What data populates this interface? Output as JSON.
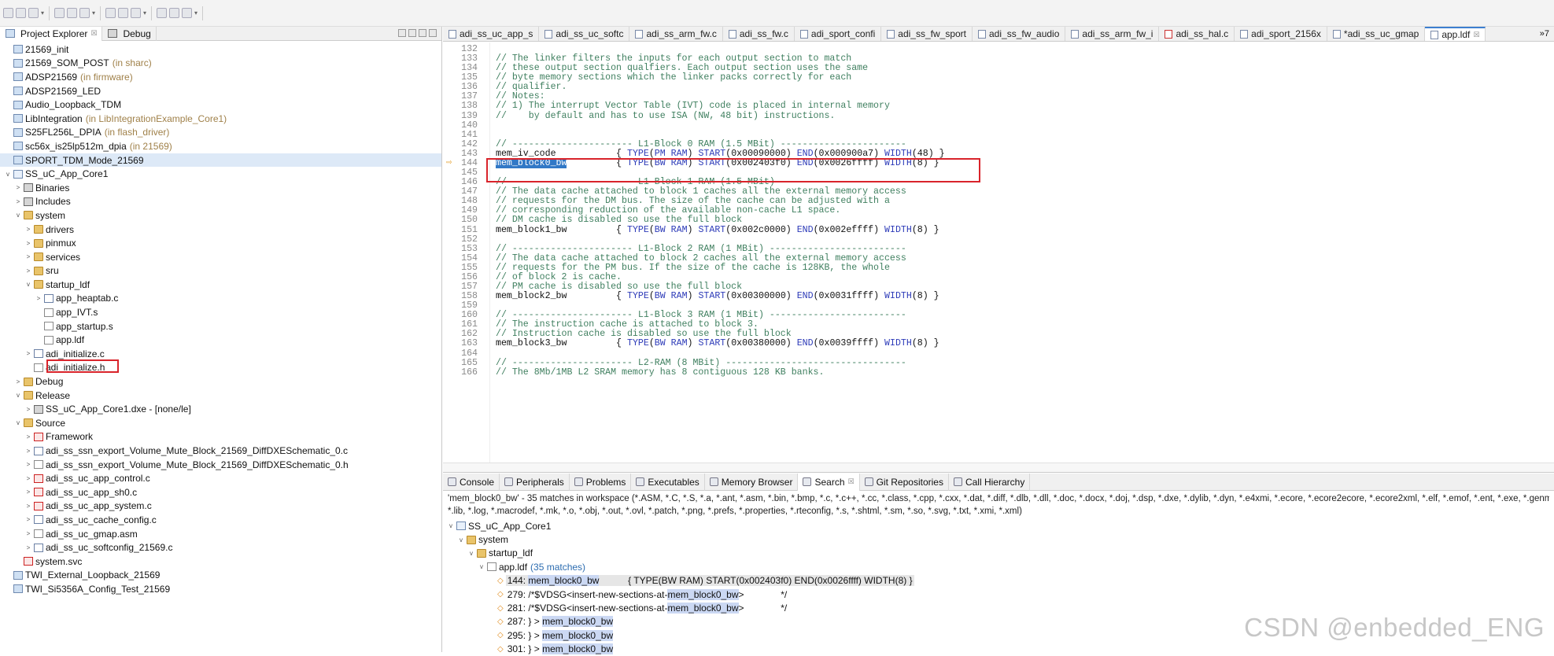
{
  "toolbar": {
    "buttons": [
      "new",
      "save",
      "save-all",
      "print",
      "debug",
      "run",
      "stop",
      "step",
      "build",
      "search",
      "back",
      "forward"
    ]
  },
  "explorer": {
    "tabs": [
      {
        "label": "Project Explorer",
        "closable": "☒"
      },
      {
        "label": "Debug"
      }
    ],
    "rows": [
      {
        "indent": 0,
        "tw": "",
        "icon": "proj",
        "label": "21569_init",
        "extra": ""
      },
      {
        "indent": 0,
        "tw": "",
        "icon": "proj",
        "label": "21569_SOM_POST",
        "extra": "(in sharc)"
      },
      {
        "indent": 0,
        "tw": "",
        "icon": "proj",
        "label": "ADSP21569",
        "extra": "(in firmware)"
      },
      {
        "indent": 0,
        "tw": "",
        "icon": "proj",
        "label": "ADSP21569_LED",
        "extra": ""
      },
      {
        "indent": 0,
        "tw": "",
        "icon": "proj",
        "label": "Audio_Loopback_TDM",
        "extra": ""
      },
      {
        "indent": 0,
        "tw": "",
        "icon": "proj",
        "label": "LibIntegration",
        "extra": "(in LibIntegrationExample_Core1)"
      },
      {
        "indent": 0,
        "tw": "",
        "icon": "proj",
        "label": "S25FL256L_DPIA",
        "extra": "(in flash_driver)"
      },
      {
        "indent": 0,
        "tw": "",
        "icon": "proj",
        "label": "sc56x_is25lp512m_dpia",
        "extra": "(in 21569)"
      },
      {
        "indent": 0,
        "tw": "",
        "icon": "proj",
        "label": "SPORT_TDM_Mode_21569",
        "extra": "",
        "sel": true
      },
      {
        "indent": 0,
        "tw": "v",
        "icon": "proj open",
        "label": "SS_uC_App_Core1",
        "extra": ""
      },
      {
        "indent": 1,
        "tw": ">",
        "icon": "binr",
        "label": "Binaries",
        "extra": ""
      },
      {
        "indent": 1,
        "tw": ">",
        "icon": "binr",
        "label": "Includes",
        "extra": ""
      },
      {
        "indent": 1,
        "tw": "v",
        "icon": "fold",
        "label": "system",
        "extra": ""
      },
      {
        "indent": 2,
        "tw": ">",
        "icon": "fold",
        "label": "drivers",
        "extra": ""
      },
      {
        "indent": 2,
        "tw": ">",
        "icon": "fold",
        "label": "pinmux",
        "extra": ""
      },
      {
        "indent": 2,
        "tw": ">",
        "icon": "fold",
        "label": "services",
        "extra": ""
      },
      {
        "indent": 2,
        "tw": ">",
        "icon": "fold",
        "label": "sru",
        "extra": ""
      },
      {
        "indent": 2,
        "tw": "v",
        "icon": "fold",
        "label": "startup_ldf",
        "extra": ""
      },
      {
        "indent": 3,
        "tw": ">",
        "icon": "file c",
        "label": "app_heaptab.c",
        "extra": ""
      },
      {
        "indent": 3,
        "tw": "",
        "icon": "file",
        "label": "app_IVT.s",
        "extra": ""
      },
      {
        "indent": 3,
        "tw": "",
        "icon": "file",
        "label": "app_startup.s",
        "extra": ""
      },
      {
        "indent": 3,
        "tw": "",
        "icon": "file",
        "label": "app.ldf",
        "extra": "",
        "boxed": true
      },
      {
        "indent": 2,
        "tw": ">",
        "icon": "file c",
        "label": "adi_initialize.c",
        "extra": ""
      },
      {
        "indent": 2,
        "tw": "",
        "icon": "file",
        "label": "adi_initialize.h",
        "extra": ""
      },
      {
        "indent": 1,
        "tw": ">",
        "icon": "fold",
        "label": "Debug",
        "extra": ""
      },
      {
        "indent": 1,
        "tw": "v",
        "icon": "fold",
        "label": "Release",
        "extra": ""
      },
      {
        "indent": 2,
        "tw": ">",
        "icon": "binr",
        "label": "SS_uC_App_Core1.dxe - [none/le]",
        "extra": ""
      },
      {
        "indent": 1,
        "tw": "v",
        "icon": "fold",
        "label": "Source",
        "extra": ""
      },
      {
        "indent": 2,
        "tw": ">",
        "icon": "file red",
        "label": "Framework",
        "extra": ""
      },
      {
        "indent": 2,
        "tw": ">",
        "icon": "file c",
        "label": "adi_ss_ssn_export_Volume_Mute_Block_21569_DiffDXESchematic_0.c",
        "extra": ""
      },
      {
        "indent": 2,
        "tw": ">",
        "icon": "file",
        "label": "adi_ss_ssn_export_Volume_Mute_Block_21569_DiffDXESchematic_0.h",
        "extra": ""
      },
      {
        "indent": 2,
        "tw": ">",
        "icon": "file red",
        "label": "adi_ss_uc_app_control.c",
        "extra": ""
      },
      {
        "indent": 2,
        "tw": ">",
        "icon": "file red",
        "label": "adi_ss_uc_app_sh0.c",
        "extra": ""
      },
      {
        "indent": 2,
        "tw": ">",
        "icon": "file red",
        "label": "adi_ss_uc_app_system.c",
        "extra": ""
      },
      {
        "indent": 2,
        "tw": ">",
        "icon": "file c",
        "label": "adi_ss_uc_cache_config.c",
        "extra": ""
      },
      {
        "indent": 2,
        "tw": ">",
        "icon": "file",
        "label": "adi_ss_uc_gmap.asm",
        "extra": ""
      },
      {
        "indent": 2,
        "tw": ">",
        "icon": "file c",
        "label": "adi_ss_uc_softconfig_21569.c",
        "extra": ""
      },
      {
        "indent": 1,
        "tw": "",
        "icon": "file red",
        "label": "system.svc",
        "extra": ""
      },
      {
        "indent": 0,
        "tw": "",
        "icon": "proj",
        "label": "TWI_External_Loopback_21569",
        "extra": ""
      },
      {
        "indent": 0,
        "tw": "",
        "icon": "proj",
        "label": "TWI_Si5356A_Config_Test_21569",
        "extra": ""
      }
    ]
  },
  "editor": {
    "tabs": [
      {
        "label": "adi_ss_uc_app_s",
        "red": false
      },
      {
        "label": "adi_ss_uc_softc",
        "red": false
      },
      {
        "label": "adi_ss_arm_fw.c",
        "red": false
      },
      {
        "label": "adi_ss_fw.c",
        "red": false
      },
      {
        "label": "adi_sport_confi",
        "red": false
      },
      {
        "label": "adi_ss_fw_sport",
        "red": false
      },
      {
        "label": "adi_ss_fw_audio",
        "red": false
      },
      {
        "label": "adi_ss_arm_fw_i",
        "red": false
      },
      {
        "label": "adi_ss_hal.c",
        "red": true
      },
      {
        "label": "adi_sport_2156x",
        "red": false
      },
      {
        "label": "*adi_ss_uc_gmap",
        "red": false
      },
      {
        "label": "app.ldf",
        "red": false,
        "active": true,
        "closable": "☒"
      }
    ],
    "overflow": "»7",
    "lines": [
      {
        "n": "132",
        "segs": []
      },
      {
        "n": "133",
        "segs": [
          [
            "cm",
            "// The linker filters the inputs for each output section to match"
          ]
        ]
      },
      {
        "n": "134",
        "segs": [
          [
            "cm",
            "// these output section qualfiers. Each output section uses the same"
          ]
        ]
      },
      {
        "n": "135",
        "segs": [
          [
            "cm",
            "// byte memory sections which the linker packs correctly for each"
          ]
        ]
      },
      {
        "n": "136",
        "segs": [
          [
            "cm",
            "// qualifier."
          ]
        ]
      },
      {
        "n": "137",
        "segs": [
          [
            "cm",
            "// Notes:"
          ]
        ]
      },
      {
        "n": "138",
        "segs": [
          [
            "cm",
            "// 1) The interrupt Vector Table (IVT) code is placed in internal memory"
          ]
        ]
      },
      {
        "n": "139",
        "segs": [
          [
            "cm",
            "//    by default and has to use ISA (NW, 48 bit) instructions."
          ]
        ]
      },
      {
        "n": "140",
        "segs": []
      },
      {
        "n": "141",
        "segs": []
      },
      {
        "n": "142",
        "segs": [
          [
            "cm",
            "// ---------------------- L1-Block 0 RAM (1.5 MBit) -----------------------"
          ]
        ]
      },
      {
        "n": "143",
        "segs": [
          [
            "",
            "mem_iv_code           { "
          ],
          [
            "kw",
            "TYPE"
          ],
          [
            "",
            "("
          ],
          [
            "kw",
            "PM RAM"
          ],
          [
            "",
            ") "
          ],
          [
            "kw",
            "START"
          ],
          [
            "",
            "(0x00090000) "
          ],
          [
            "kw",
            "END"
          ],
          [
            "",
            "(0x000900a7) "
          ],
          [
            "kw",
            "WIDTH"
          ],
          [
            "",
            "(48) }"
          ]
        ]
      },
      {
        "n": "144",
        "mark": "⇨",
        "segs": [
          [
            "hl",
            "mem_block0_bw"
          ],
          [
            "",
            "         { "
          ],
          [
            "kw",
            "TYPE"
          ],
          [
            "",
            "("
          ],
          [
            "kw",
            "BW RAM"
          ],
          [
            "",
            ") "
          ],
          [
            "kw",
            "START"
          ],
          [
            "",
            "(0x002403f0) "
          ],
          [
            "kw",
            "END"
          ],
          [
            "",
            "(0x0026ffff) "
          ],
          [
            "kw",
            "WIDTH"
          ],
          [
            "",
            "(8) }"
          ]
        ]
      },
      {
        "n": "145",
        "segs": []
      },
      {
        "n": "146",
        "segs": [
          [
            "cm",
            "// ---------------------- L1-Block 1 RAM (1.5 MBit) -----------------------"
          ]
        ]
      },
      {
        "n": "147",
        "segs": [
          [
            "cm",
            "// The data cache attached to block 1 caches all the external memory access"
          ]
        ]
      },
      {
        "n": "148",
        "segs": [
          [
            "cm",
            "// requests for the DM bus. The size of the cache can be adjusted with a"
          ]
        ]
      },
      {
        "n": "149",
        "segs": [
          [
            "cm",
            "// corresponding reduction of the available non-cache L1 space."
          ]
        ]
      },
      {
        "n": "150",
        "segs": [
          [
            "cm",
            "// DM cache is disabled so use the full block"
          ]
        ]
      },
      {
        "n": "151",
        "segs": [
          [
            "",
            "mem_block1_bw         { "
          ],
          [
            "kw",
            "TYPE"
          ],
          [
            "",
            "("
          ],
          [
            "kw",
            "BW RAM"
          ],
          [
            "",
            ") "
          ],
          [
            "kw",
            "START"
          ],
          [
            "",
            "(0x002c0000) "
          ],
          [
            "kw",
            "END"
          ],
          [
            "",
            "(0x002effff) "
          ],
          [
            "kw",
            "WIDTH"
          ],
          [
            "",
            "(8) }"
          ]
        ]
      },
      {
        "n": "152",
        "segs": []
      },
      {
        "n": "153",
        "segs": [
          [
            "cm",
            "// ---------------------- L1-Block 2 RAM (1 MBit) -------------------------"
          ]
        ]
      },
      {
        "n": "154",
        "segs": [
          [
            "cm",
            "// The data cache attached to block 2 caches all the external memory access"
          ]
        ]
      },
      {
        "n": "155",
        "segs": [
          [
            "cm",
            "// requests for the PM bus. If the size of the cache is 128KB, the whole"
          ]
        ]
      },
      {
        "n": "156",
        "segs": [
          [
            "cm",
            "// of block 2 is cache."
          ]
        ]
      },
      {
        "n": "157",
        "segs": [
          [
            "cm",
            "// PM cache is disabled so use the full block"
          ]
        ]
      },
      {
        "n": "158",
        "segs": [
          [
            "",
            "mem_block2_bw         { "
          ],
          [
            "kw",
            "TYPE"
          ],
          [
            "",
            "("
          ],
          [
            "kw",
            "BW RAM"
          ],
          [
            "",
            ") "
          ],
          [
            "kw",
            "START"
          ],
          [
            "",
            "(0x00300000) "
          ],
          [
            "kw",
            "END"
          ],
          [
            "",
            "(0x0031ffff) "
          ],
          [
            "kw",
            "WIDTH"
          ],
          [
            "",
            "(8) }"
          ]
        ]
      },
      {
        "n": "159",
        "segs": []
      },
      {
        "n": "160",
        "segs": [
          [
            "cm",
            "// ---------------------- L1-Block 3 RAM (1 MBit) -------------------------"
          ]
        ]
      },
      {
        "n": "161",
        "segs": [
          [
            "cm",
            "// The instruction cache is attached to block 3."
          ]
        ]
      },
      {
        "n": "162",
        "segs": [
          [
            "cm",
            "// Instruction cache is disabled so use the full block"
          ]
        ]
      },
      {
        "n": "163",
        "segs": [
          [
            "",
            "mem_block3_bw         { "
          ],
          [
            "kw",
            "TYPE"
          ],
          [
            "",
            "("
          ],
          [
            "kw",
            "BW RAM"
          ],
          [
            "",
            ") "
          ],
          [
            "kw",
            "START"
          ],
          [
            "",
            "(0x00380000) "
          ],
          [
            "kw",
            "END"
          ],
          [
            "",
            "(0x0039ffff) "
          ],
          [
            "kw",
            "WIDTH"
          ],
          [
            "",
            "(8) }"
          ]
        ]
      },
      {
        "n": "164",
        "segs": []
      },
      {
        "n": "165",
        "segs": [
          [
            "cm",
            "// ---------------------- L2-RAM (8 MBit) ---------------------------------"
          ]
        ]
      },
      {
        "n": "166",
        "segs": [
          [
            "cm",
            "// The 8Mb/1MB L2 SRAM memory has 8 contiguous 128 KB banks."
          ]
        ]
      }
    ]
  },
  "bottom": {
    "tabs": [
      {
        "label": "Console"
      },
      {
        "label": "Peripherals"
      },
      {
        "label": "Problems"
      },
      {
        "label": "Executables"
      },
      {
        "label": "Memory Browser"
      },
      {
        "label": "Search",
        "active": true,
        "closable": "☒"
      },
      {
        "label": "Git Repositories"
      },
      {
        "label": "Call Hierarchy"
      }
    ],
    "summary1": "'mem_block0_bw' - 35 matches in workspace (*.ASM, *.C, *.S, *.a, *.ant, *.asm, *.bin, *.bmp, *.c, *.c++, *.cc, *.class, *.cpp, *.cxx, *.dat, *.diff, *.dlb, *.dll, *.doc, *.docx, *.doj, *.dsp, *.dxe, *.dylib, *.dyn, *.e4xmi, *.ecore, *.ecore2ecore, *.ecore2xml, *.elf, *.emof, *.ent, *.exe, *.genmodel, *.gif, *.gitignore, *.h",
    "summary2": "*.lib, *.log, *.macrodef, *.mk, *.o, *.obj, *.out, *.ovl, *.patch, *.png, *.prefs, *.properties, *.rteconfig, *.s, *.shtml, *.sm, *.so, *.svg, *.txt, *.xmi, *.xml)",
    "tree": [
      {
        "indent": 0,
        "tw": "v",
        "icon": "proj open",
        "label": "SS_uC_App_Core1"
      },
      {
        "indent": 1,
        "tw": "v",
        "icon": "fold",
        "label": "system"
      },
      {
        "indent": 2,
        "tw": "v",
        "icon": "fold",
        "label": "startup_ldf"
      },
      {
        "indent": 3,
        "tw": "v",
        "icon": "file",
        "label": "app.ldf",
        "count": "(35 matches)"
      }
    ],
    "results": [
      {
        "prefix": "144: ",
        "match": "mem_block0_bw",
        "suffix": "           { TYPE(BW RAM) START(0x002403f0) END(0x0026ffff) WIDTH(8) }",
        "row": true
      },
      {
        "prefix": "279: /*$VDSG<insert-new-sections-at-",
        "match": "mem_block0_bw",
        "suffix": ">              */"
      },
      {
        "prefix": "281: /*$VDSG<insert-new-sections-at-",
        "match": "mem_block0_bw",
        "suffix": ">              */"
      },
      {
        "prefix": "287: } > ",
        "match": "mem_block0_bw",
        "suffix": ""
      },
      {
        "prefix": "295: } > ",
        "match": "mem_block0_bw",
        "suffix": ""
      },
      {
        "prefix": "301: } > ",
        "match": "mem_block0_bw",
        "suffix": ""
      }
    ]
  },
  "watermark": "CSDN @enbedded_ENG"
}
